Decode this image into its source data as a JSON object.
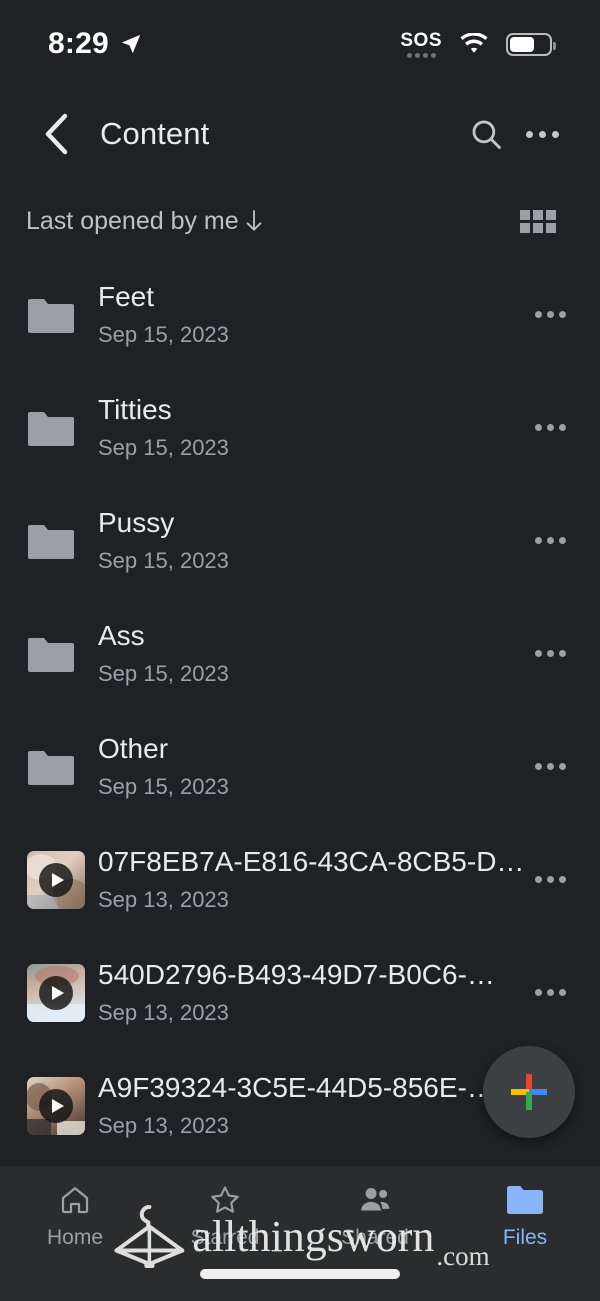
{
  "status_bar": {
    "time": "8:29",
    "location_icon": "location-arrow-icon",
    "sos_label": "SOS",
    "wifi_icon": "wifi-icon",
    "battery_icon": "battery-icon",
    "battery_level_pct": 62
  },
  "app_bar": {
    "back_icon": "chevron-left-icon",
    "title": "Content",
    "search_icon": "search-icon",
    "overflow_icon": "more-vertical-icon"
  },
  "sort_bar": {
    "sort_label": "Last opened by me",
    "sort_direction_icon": "arrow-down-icon",
    "view_toggle_icon": "grid-view-icon"
  },
  "items": [
    {
      "name": "Feet",
      "date": "Sep 15, 2023",
      "type": "folder"
    },
    {
      "name": "Titties",
      "date": "Sep 15, 2023",
      "type": "folder"
    },
    {
      "name": "Pussy",
      "date": "Sep 15, 2023",
      "type": "folder"
    },
    {
      "name": "Ass",
      "date": "Sep 15, 2023",
      "type": "folder"
    },
    {
      "name": "Other",
      "date": "Sep 15, 2023",
      "type": "folder"
    },
    {
      "name": "07F8EB7A-E816-43CA-8CB5-D…",
      "date": "Sep 13, 2023",
      "type": "video"
    },
    {
      "name": "540D2796-B493-49D7-B0C6-…",
      "date": "Sep 13, 2023",
      "type": "video"
    },
    {
      "name": "A9F39324-3C5E-44D5-856E-…",
      "date": "Sep 13, 2023",
      "type": "video"
    }
  ],
  "fab": {
    "icon": "google-plus-add-icon",
    "label": "Create new"
  },
  "bottom_nav": {
    "items": [
      {
        "label": "Home",
        "icon": "home-icon",
        "active": false
      },
      {
        "label": "Starred",
        "icon": "star-icon",
        "active": false
      },
      {
        "label": "Shared",
        "icon": "people-icon",
        "active": false
      },
      {
        "label": "Files",
        "icon": "folder-icon",
        "active": true
      }
    ]
  },
  "watermark": {
    "name": "allthingsworn",
    "tld": ".com",
    "logo_icon": "clothes-hanger-icon"
  },
  "colors": {
    "background": "#202124",
    "nav_background": "#2a2c2e",
    "primary_text": "#e8eaed",
    "secondary_text": "#9aa0a6",
    "accent_active": "#8ab4f8",
    "folder_gray": "#9aa0a6",
    "fab_background": "#3c4043",
    "google_red": "#ea4335",
    "google_blue": "#4285f4",
    "google_green": "#34a853",
    "google_yellow": "#fbbc04"
  }
}
